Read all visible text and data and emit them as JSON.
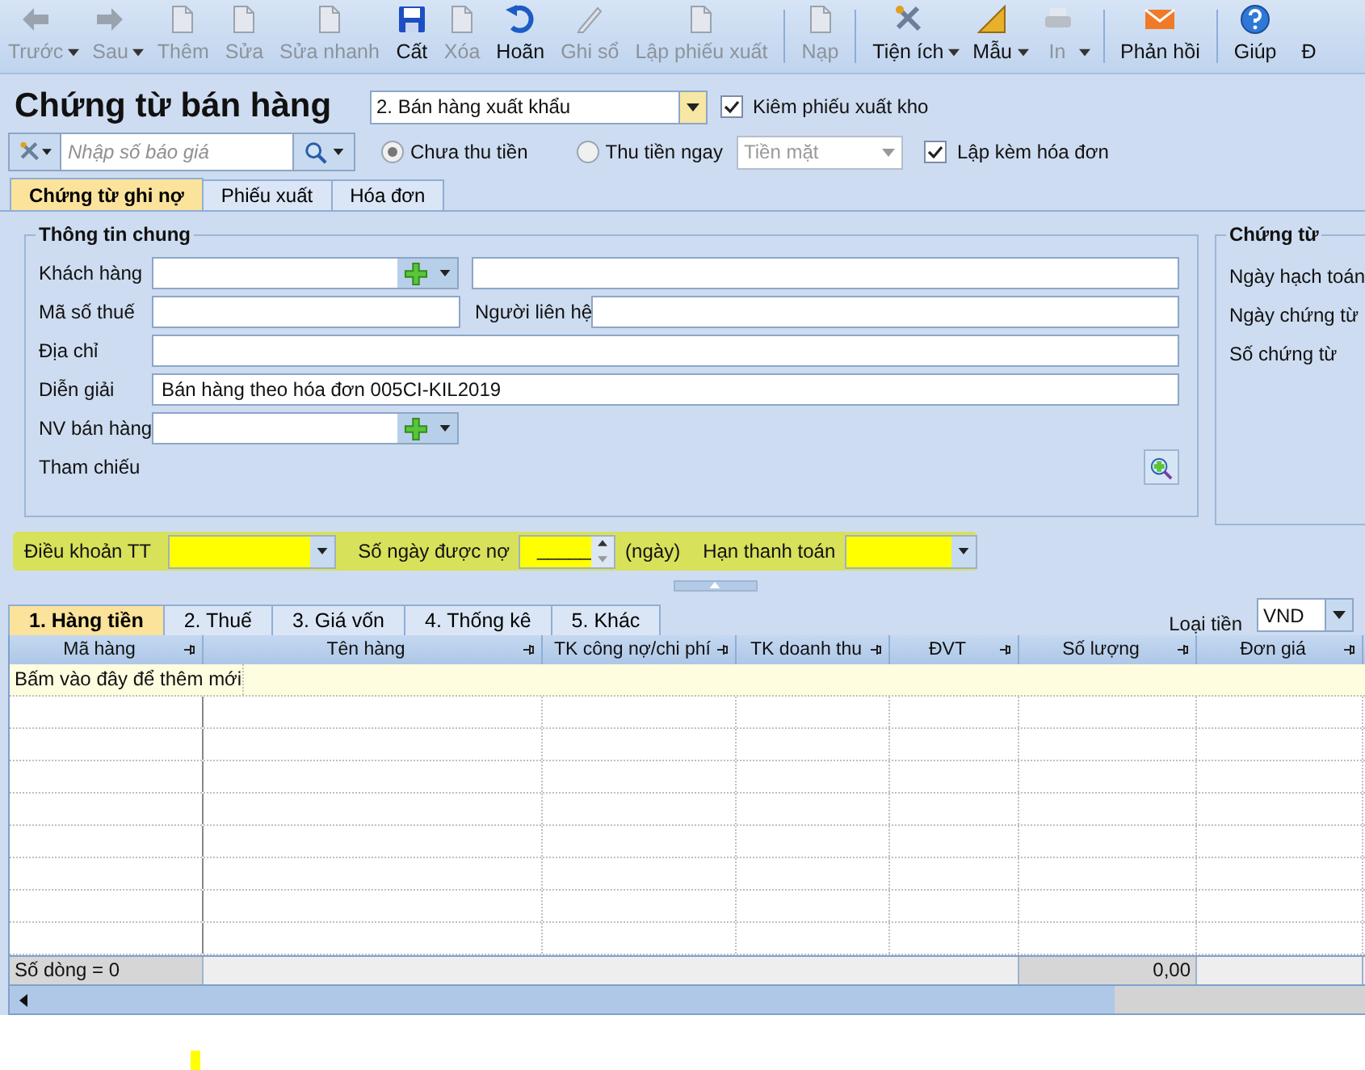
{
  "toolbar": [
    {
      "label": "Trước",
      "disabled": true,
      "dropdown": true
    },
    {
      "label": "Sau",
      "disabled": true,
      "dropdown": true
    },
    {
      "label": "Thêm",
      "disabled": true,
      "dropdown": false
    },
    {
      "label": "Sửa",
      "disabled": true,
      "dropdown": false
    },
    {
      "label": "Sửa nhanh",
      "disabled": true,
      "dropdown": false
    },
    {
      "label": "Cất",
      "disabled": false,
      "dropdown": false
    },
    {
      "label": "Xóa",
      "disabled": true,
      "dropdown": false
    },
    {
      "label": "Hoãn",
      "disabled": false,
      "dropdown": false
    },
    {
      "label": "Ghi sổ",
      "disabled": true,
      "dropdown": false
    },
    {
      "label": "Lập phiếu xuất",
      "disabled": true,
      "dropdown": false
    },
    {
      "label": "Nạp",
      "disabled": true,
      "dropdown": false
    },
    {
      "label": "Tiện ích",
      "disabled": false,
      "dropdown": true
    },
    {
      "label": "Mẫu",
      "disabled": false,
      "dropdown": true
    },
    {
      "label": "In",
      "disabled": true,
      "dropdown": true
    },
    {
      "label": "Phản hồi",
      "disabled": false,
      "dropdown": false
    },
    {
      "label": "Giúp",
      "disabled": false,
      "dropdown": false
    },
    {
      "label": "Đ",
      "disabled": false,
      "dropdown": false
    }
  ],
  "header": {
    "title": "Chứng từ bán hàng",
    "type_select": "2. Bán hàng xuất khẩu",
    "stock_option": {
      "label": "Kiêm phiếu xuất kho",
      "checked": true
    }
  },
  "search": {
    "placeholder": "Nhập số báo giá"
  },
  "payment": [
    {
      "label": "Chưa thu tiền",
      "selected": true
    },
    {
      "label": "Thu tiền ngay",
      "selected": false
    }
  ],
  "payment_method": {
    "value": "Tiền mặt",
    "disabled": true
  },
  "invoice_option": {
    "label": "Lập kèm hóa đơn",
    "checked": true
  },
  "tabs": [
    {
      "label": "Chứng từ ghi nợ",
      "selected": true
    },
    {
      "label": "Phiếu xuất",
      "selected": false
    },
    {
      "label": "Hóa đơn",
      "selected": false
    }
  ],
  "general": {
    "title": "Thông tin chung",
    "customer_label": "Khách hàng",
    "tax_label": "Mã số thuế",
    "contact_label": "Người liên hệ",
    "address_label": "Địa chỉ",
    "description_label": "Diễn giải",
    "description_value": "Bán hàng theo hóa đơn 005CI-KIL2019",
    "salesperson_label": "NV bán hàng",
    "reference_label": "Tham chiếu"
  },
  "voucher": {
    "title": "Chứng từ",
    "labels": [
      "Ngày hạch toán",
      "Ngày chứng từ",
      "Số chứng từ"
    ]
  },
  "terms": {
    "terms_label": "Điều khoản TT",
    "days_label": "Số ngày được nợ",
    "days_value": "_____",
    "days_unit": "(ngày)",
    "due_label": "Hạn thanh toán"
  },
  "detail_tabs": [
    {
      "label": "1. Hàng tiền",
      "selected": true
    },
    {
      "label": "2. Thuế",
      "selected": false
    },
    {
      "label": "3. Giá vốn",
      "selected": false
    },
    {
      "label": "4. Thống kê",
      "selected": false
    },
    {
      "label": "5. Khác",
      "selected": false
    }
  ],
  "currency": {
    "label": "Loại tiền",
    "value": "VND"
  },
  "table": {
    "columns": [
      "Mã hàng",
      "Tên hàng",
      "TK công nợ/chi phí",
      "TK doanh thu",
      "ĐVT",
      "Số lượng",
      "Đơn giá"
    ],
    "new_row_hint": "Bấm vào đây để thêm mới",
    "row_count": "Số dòng = 0",
    "quantity_total": "0,00"
  }
}
